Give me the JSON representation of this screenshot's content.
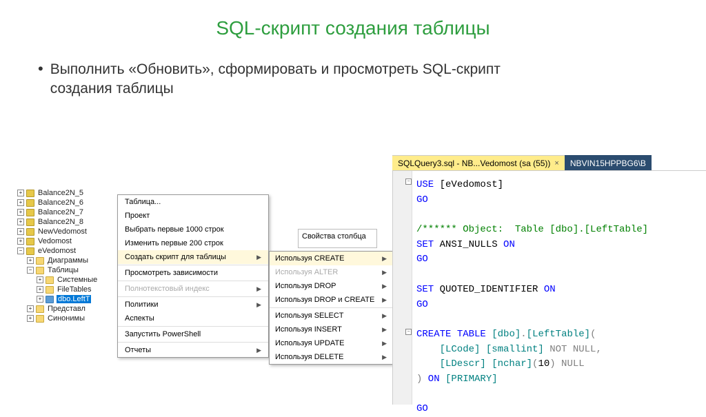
{
  "title": "SQL-скрипт создания таблицы",
  "bullet": "Выполнить «Обновить», сформировать и просмотреть SQL-скрипт создания таблицы",
  "tree": {
    "db1": "Balance2N_5",
    "db2": "Balance2N_6",
    "db3": "Balance2N_7",
    "db4": "Balance2N_8",
    "db5": "NewVedomost",
    "db6": "Vedomost",
    "db7": "eVedomost",
    "fld1": "Диаграммы",
    "fld2": "Таблицы",
    "fld3": "Системные",
    "fld4": "FileTables",
    "tbl1": "dbo.LeftT",
    "fld5": "Представл",
    "fld6": "Синонимы"
  },
  "menu": {
    "m1": "Таблица...",
    "m2": "Проект",
    "m3": "Выбрать первые 1000 строк",
    "m4": "Изменить первые 200 строк",
    "m5": "Создать скрипт для таблицы",
    "m6": "Просмотреть зависимости",
    "m7": "Полнотекстовый индекс",
    "m8": "Политики",
    "m9": "Аспекты",
    "m10": "Запустить PowerShell",
    "m11": "Отчеты"
  },
  "submenu": {
    "s1": "Используя CREATE",
    "s2": "Используя ALTER",
    "s3": "Используя DROP",
    "s4": "Используя DROP и CREATE",
    "s5": "Используя SELECT",
    "s6": "Используя INSERT",
    "s7": "Используя UPDATE",
    "s8": "Используя DELETE"
  },
  "propbox": "Свойства столбца",
  "tabs": {
    "active": "SQLQuery3.sql - NB...Vedomost (sa (55))",
    "inactive": "NBVIN15HPPBG6\\B"
  },
  "code": {
    "l1a": "USE",
    "l1b": " [eVedomost]",
    "l2": "GO",
    "l4a": "/****** Object:  Table [dbo].[LeftTable]",
    "l5a": "SET",
    "l5b": " ANSI_NULLS ",
    "l5c": "ON",
    "l6": "GO",
    "l8a": "SET",
    "l8b": " QUOTED_IDENTIFIER ",
    "l8c": "ON",
    "l9": "GO",
    "l11a": "CREATE",
    "l11b": " TABLE",
    "l11c": " [dbo]",
    "l11d": ".",
    "l11e": "[LeftTable]",
    "l11f": "(",
    "l12a": "    [LCode] [smallint] ",
    "l12b": "NOT NULL",
    "l12c": ",",
    "l13a": "    [LDescr] [nchar]",
    "l13b": "(",
    "l13c": "10",
    "l13d": ")",
    "l13e": " NULL",
    "l14a": ")",
    "l14b": " ON",
    "l14c": " [PRIMARY]",
    "l16": "GO"
  }
}
